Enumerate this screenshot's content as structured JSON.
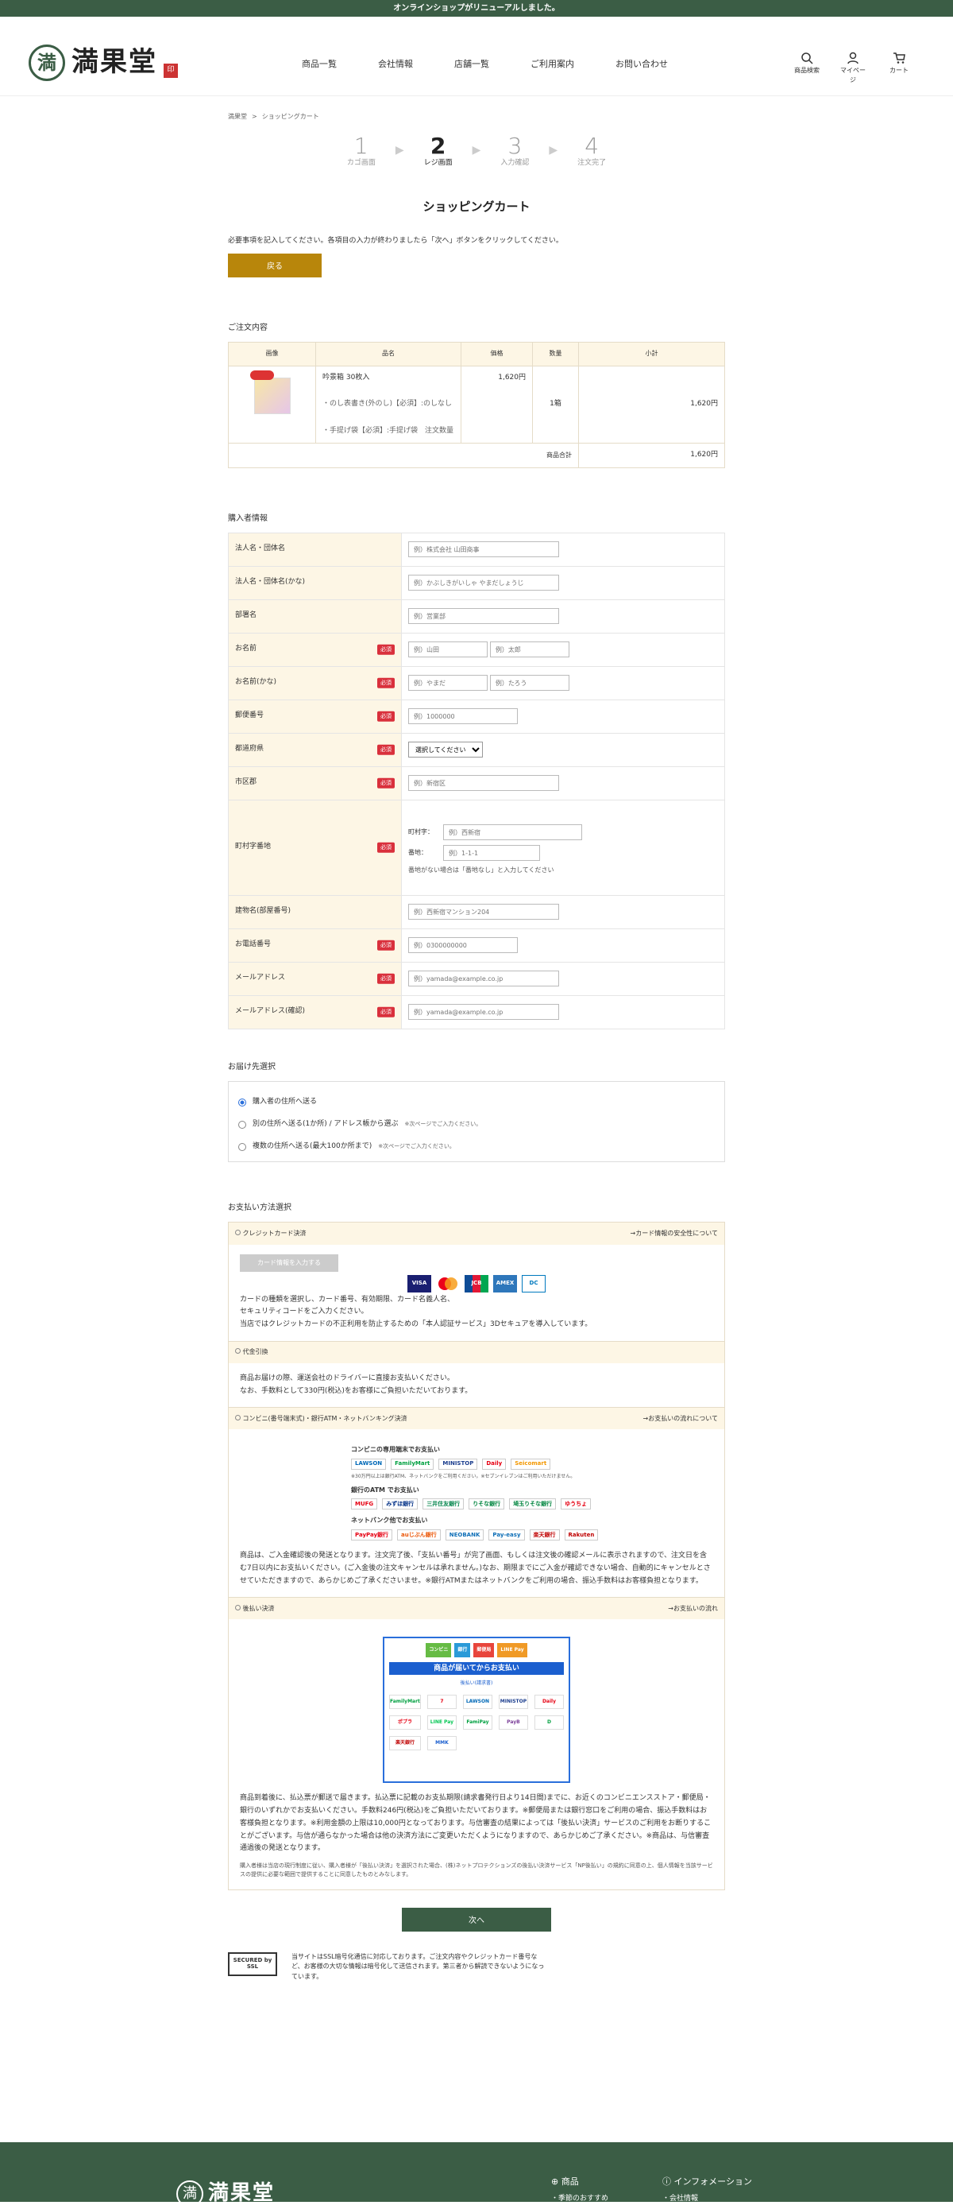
{
  "announcement": "オンラインショップがリニューアルしました。",
  "logo": {
    "mark": "満",
    "text": "満果堂",
    "seal": "印"
  },
  "nav": [
    "商品一覧",
    "会社情報",
    "店舗一覧",
    "ご利用案内",
    "お問い合わせ"
  ],
  "header_icons": [
    {
      "label": "商品検索",
      "icon": "search-icon"
    },
    {
      "label": "マイページ",
      "icon": "user-icon"
    },
    {
      "label": "カート",
      "icon": "cart-icon"
    }
  ],
  "breadcrumb": [
    "満果堂",
    "ショッピングカート"
  ],
  "steps": [
    {
      "num": "1",
      "label": "カゴ画面"
    },
    {
      "num": "2",
      "label": "レジ画面"
    },
    {
      "num": "3",
      "label": "入力確認"
    },
    {
      "num": "4",
      "label": "注文完了"
    }
  ],
  "page_title": "ショッピングカート",
  "intro": "必要事項を記入してください。各項目の入力が終わりましたら「次へ」ボタンをクリックしてください。",
  "back_label": "戻る",
  "order": {
    "title": "ご注文内容",
    "headers": [
      "画像",
      "品名",
      "価格",
      "数量",
      "小計"
    ],
    "item": {
      "name": "吟景箱 30枚入",
      "option1": "・のし表書き(外のし)【必須】:のしなし",
      "option2": "・手提げ袋【必須】:手提げ袋　注文数量",
      "price": "1,620円",
      "qty": "1箱",
      "subtotal": "1,620円"
    },
    "total_label": "商品合計",
    "total": "1,620円"
  },
  "buyer": {
    "title": "購入者情報",
    "required": "必須",
    "rows": {
      "corp": {
        "label": "法人名・団体名",
        "ph": "例）株式会社 山田商事"
      },
      "corp_kana": {
        "label": "法人名・団体名(かな)",
        "ph": "例）かぶしきがいしゃ やまだしょうじ"
      },
      "dept": {
        "label": "部署名",
        "ph": "例）営業部"
      },
      "name": {
        "label": "お名前",
        "ph1": "例）山田",
        "ph2": "例）太郎"
      },
      "kana": {
        "label": "お名前(かな)",
        "ph1": "例）やまだ",
        "ph2": "例）たろう"
      },
      "zip": {
        "label": "郵便番号",
        "ph": "例）1000000"
      },
      "pref": {
        "label": "都道府県",
        "value": "選択してください"
      },
      "city": {
        "label": "市区郡",
        "ph": "例）新宿区"
      },
      "addr": {
        "label": "町村字番地",
        "sub1": "町村字：",
        "ph1": "例）西新宿",
        "sub2": "番地：",
        "ph2": "例）1-1-1",
        "note": "番地がない場合は「番地なし」と入力してください"
      },
      "bldg": {
        "label": "建物名(部屋番号)",
        "ph": "例）西新宿マンション204"
      },
      "tel": {
        "label": "お電話番号",
        "ph": "例）0300000000"
      },
      "mail": {
        "label": "メールアドレス",
        "ph": "例）yamada@example.co.jp"
      },
      "mail2": {
        "label": "メールアドレス(確認)",
        "ph": "例）yamada@example.co.jp"
      }
    }
  },
  "shipping": {
    "title": "お届け先選択",
    "options": [
      {
        "label": "購入者の住所へ送る",
        "note": ""
      },
      {
        "label": "別の住所へ送る(1か所) / アドレス帳から選ぶ",
        "note": "※次ページでご入力ください。"
      },
      {
        "label": "複数の住所へ送る(最大100か所まで)",
        "note": "※次ページでご入力ください。"
      }
    ]
  },
  "payment": {
    "title": "お支払い方法選択",
    "card": {
      "label": "クレジットカード決済",
      "link": "→カード情報の安全性について",
      "btn": "カード情報を入力する",
      "brands": [
        "VISA",
        "MC",
        "JCB",
        "AMEX",
        "DC"
      ],
      "text1": "カードの種類を選択し、カード番号、有効期限、カード名義人名、",
      "text2": "セキュリティコードをご入力ください。",
      "text3": "当店ではクレジットカードの不正利用を防止するための「本人認証サービス」3Dセキュアを導入しています。"
    },
    "cod": {
      "label": "代金引換",
      "text1": "商品お届けの際、運送会社のドライバーに直接お支払いください。",
      "text2": "なお、手数料として330円(税込)をお客様にご負担いただいております。"
    },
    "conv": {
      "label": "コンビニ(番号端末式)・銀行ATM・ネットバンキング決済",
      "link": "→お支払いの流れについて",
      "h1": "コンビニの専用端末でお支払い",
      "l1": [
        "LAWSON",
        "FamilyMart",
        "MINISTOP",
        "Daily",
        "Seicomart"
      ],
      "n1": "※30万円以上は銀行ATM、ネットバンクをご利用ください。※セブンイレブンはご利用いただけません。",
      "h2": "銀行のATM でお支払い",
      "l2": [
        "MUFG",
        "みずほ銀行",
        "三井住友銀行",
        "りそな銀行",
        "埼玉りそな銀行",
        "ゆうちょ"
      ],
      "h3": "ネットバンク他でお支払い",
      "l3": [
        "PayPay銀行",
        "auじぶん銀行",
        "NEOBANK",
        "Pay-easy",
        "楽天銀行",
        "Rakuten"
      ],
      "text": "商品は、ご入金確認後の発送となります。注文完了後、「支払い番号」が完了画面、もしくは注文後の確認メールに表示されますので、注文日を含む7日以内にお支払いください。(ご入金後の注文キャンセルは承れません。)なお、期限までにご入金が確認できない場合、自動的にキャンセルとさせていただきますので、あらかじめご了承くださいませ。※銀行ATMまたはネットバンクをご利用の場合、振込手数料はお客様負担となります。"
    },
    "after": {
      "label": "後払い決済",
      "link": "→お支払いの流れ",
      "top": [
        "コンビニ",
        "銀行",
        "郵便局",
        "LINE Pay"
      ],
      "banner": "商品が届いてからお支払い",
      "sub": "後払い(請求書)",
      "logos": [
        "FamilyMart",
        "7",
        "LAWSON",
        "MINISTOP",
        "Daily",
        "ポプラ",
        "LINE Pay",
        "FamiPay",
        "PayB",
        "D",
        "楽天銀行",
        "MMK"
      ],
      "text": "商品到着後に、払込票が郵送で届きます。払込票に記載のお支払期限(請求書発行日より14日間)までに、お近くのコンビニエンスストア・郵便局・銀行のいずれかでお支払いください。手数料246円(税込)をご負担いただいております。※郵便局または銀行窓口をご利用の場合、振込手数料はお客様負担となります。※利用金額の上限は10,000円となっております。与信審査の結果によっては「後払い決済」サービスのご利用をお断りすることがございます。与信が通らなかった場合は他の決済方法にご変更いただくようになりますので、あらかじめご了承ください。※商品は、与信審査通過後の発送となります。",
      "small": "購入者様は当店の現行制度に従い、購入者様が「後払い決済」を選択された場合、(株)ネットプロテクションズの後払い決済サービス「NP後払い」の規約に同意の上、個人情報を当該サービスの提供に必要な範囲で提供することに同意したものとみなします。"
    }
  },
  "next_label": "次へ",
  "ssl": {
    "badge": "SECURED by SSL",
    "text": "当サイトはSSL暗号化通信に対応しております。ご注文内容やクレジットカード番号など、お客様の大切な情報は暗号化して送信されます。第三者から解読できないようになっています。"
  },
  "footer": {
    "logo": "満果堂",
    "col1": "商品",
    "col1sub": "・季節のおすすめ",
    "col2": "インフォメーション",
    "col2sub": "・会社情報"
  }
}
